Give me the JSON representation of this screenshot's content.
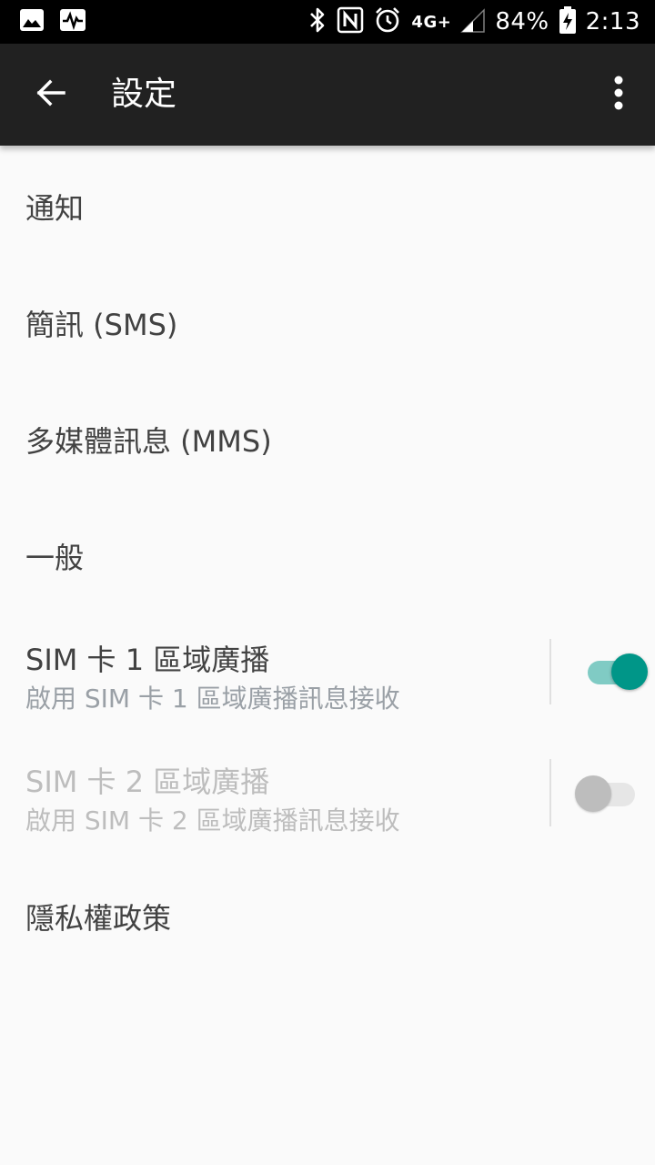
{
  "status_bar": {
    "battery": "84%",
    "time": "2:13",
    "network": "4G+",
    "icons": [
      "image-icon",
      "activity-icon",
      "bluetooth-icon",
      "nfc-icon",
      "alarm-icon",
      "signal-icon",
      "battery-charging-icon"
    ]
  },
  "toolbar": {
    "title": "設定",
    "back_icon": "arrow-back-icon",
    "menu_icon": "more-vert-icon"
  },
  "settings": [
    {
      "label": "通知"
    },
    {
      "label": "簡訊 (SMS)"
    },
    {
      "label": "多媒體訊息 (MMS)"
    },
    {
      "label": "一般"
    },
    {
      "label": "SIM 卡 1 區域廣播",
      "summary": "啟用 SIM 卡 1 區域廣播訊息接收",
      "toggle": true,
      "enabled": true
    },
    {
      "label": "SIM 卡 2 區域廣播",
      "summary": "啟用 SIM 卡 2 區域廣播訊息接收",
      "toggle": false,
      "enabled": false
    },
    {
      "label": "隱私權政策"
    }
  ],
  "colors": {
    "accent": "#009688",
    "accent_track": "#80cbc4",
    "toolbar": "#212121",
    "background": "#fafafa"
  }
}
